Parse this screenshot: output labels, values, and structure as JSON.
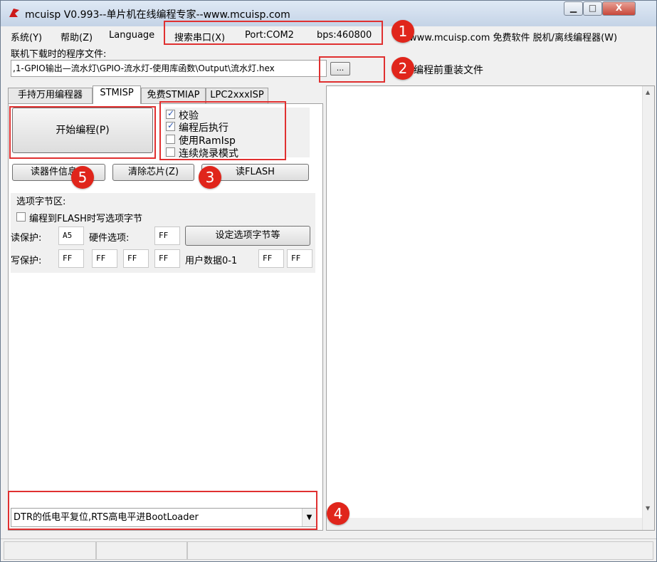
{
  "window": {
    "title": "mcuisp V0.993--单片机在线编程专家--www.mcuisp.com",
    "min_label": "▁",
    "max_label": "□",
    "close_label": "X"
  },
  "menu": {
    "system": "系统(Y)",
    "help": "帮助(Z)",
    "language": "Language",
    "search_port": "搜索串口(X)",
    "port": "Port:COM2",
    "bps": "bps:460800",
    "site": "www.mcuisp.com 免费软件 脱机/离线编程器(W)"
  },
  "file": {
    "label": "联机下载时的程序文件:",
    "path": ",1-GPIO输出—流水灯\\GPIO-流水灯-使用库函数\\Output\\流水灯.hex",
    "browse_label": "...",
    "reload_label": "编程前重装文件"
  },
  "tabs": [
    {
      "label": "手持万用编程器"
    },
    {
      "label": "STMISP"
    },
    {
      "label": "免费STMIAP"
    },
    {
      "label": "LPC2xxxISP"
    }
  ],
  "buttons": {
    "start_program": "开始编程(P)",
    "read_device_info": "读器件信息(I)",
    "clear_chip": "清除芯片(Z)",
    "read_flash": "读FLASH",
    "set_option_bytes": "设定选项字节等"
  },
  "checkboxes": [
    {
      "label": "校验",
      "checked": true
    },
    {
      "label": "编程后执行",
      "checked": true
    },
    {
      "label": "使用RamIsp",
      "checked": false
    },
    {
      "label": "连续烧录模式",
      "checked": false
    }
  ],
  "option_bytes": {
    "title": "选项字节区:",
    "program_option": "编程到FLASH时写选项字节",
    "program_option_checked": false,
    "read_protect_label": "读保护:",
    "read_protect_value": "A5",
    "hw_option_label": "硬件选项:",
    "hw_option_value": "FF",
    "write_protect_label": "写保护:",
    "write_protect_values": [
      "FF",
      "FF",
      "FF",
      "FF"
    ],
    "user_data_label": "用户数据0-1",
    "user_data_values": [
      "FF",
      "FF"
    ]
  },
  "reset_mode": {
    "selected": "DTR的低电平复位,RTS高电平进BootLoader"
  },
  "badges": [
    "1",
    "2",
    "3",
    "4",
    "5"
  ],
  "colors": {
    "annotation_red": "#e03030",
    "badge_red": "#e0251b",
    "check_blue": "#2a55b0"
  }
}
